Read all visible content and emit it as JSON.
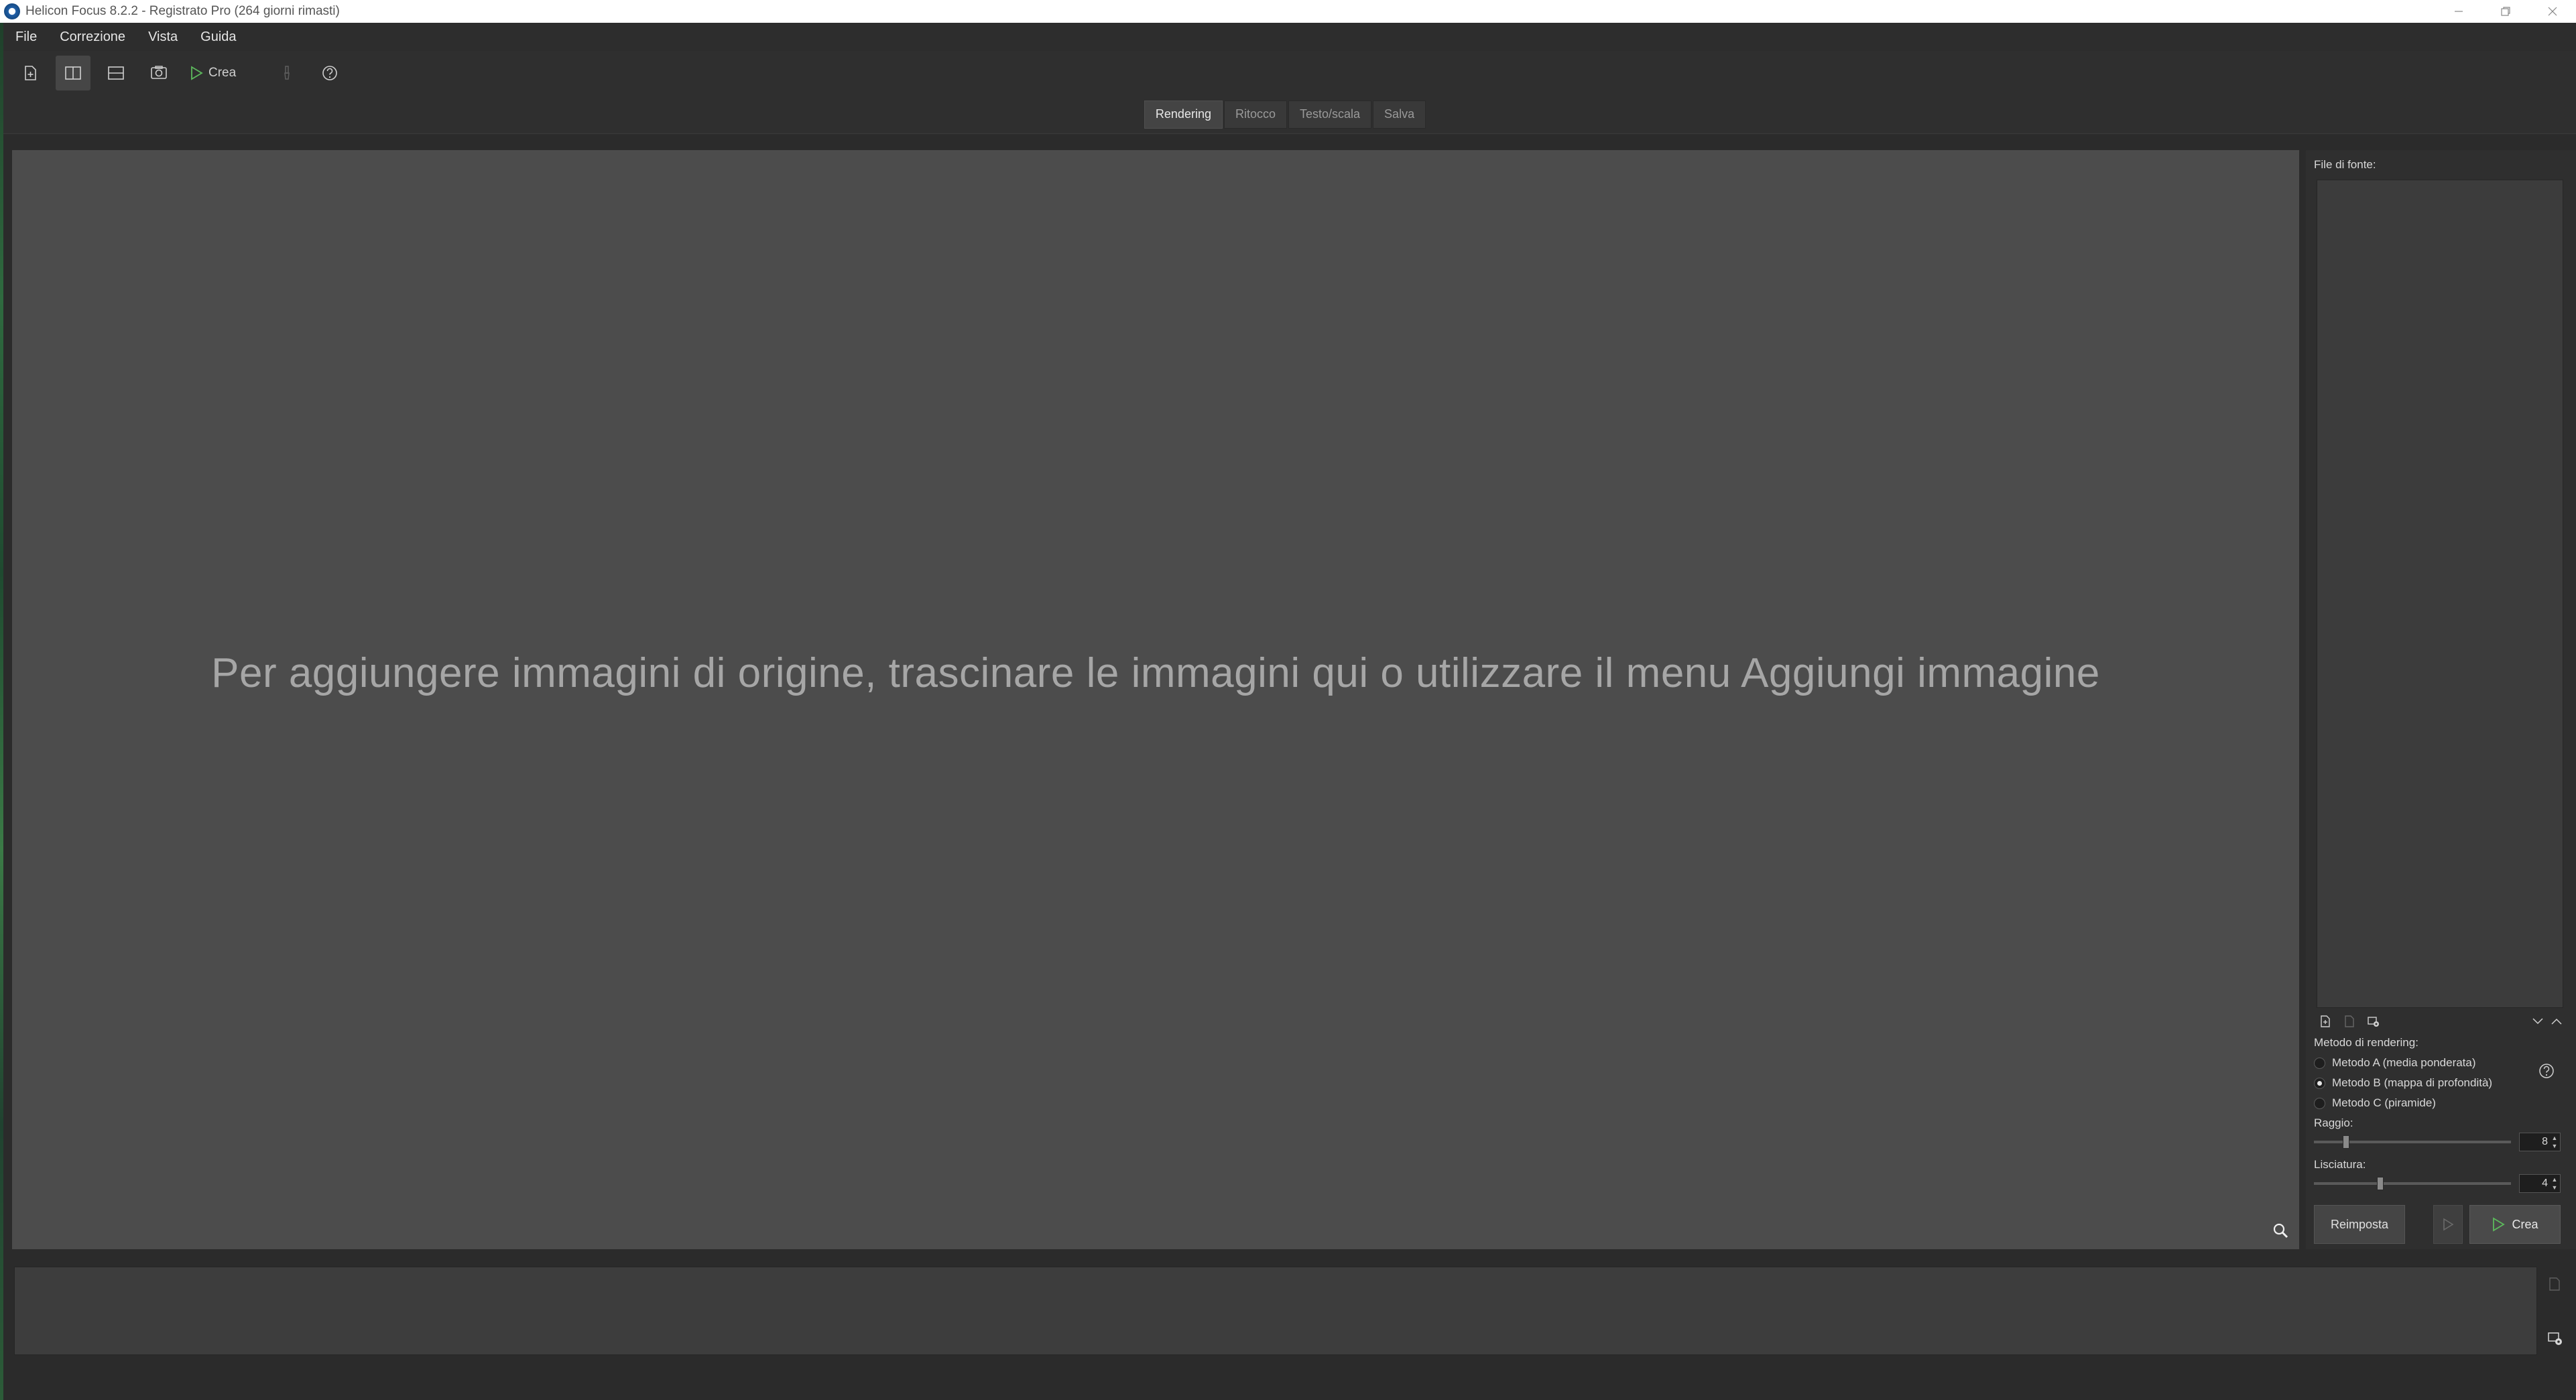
{
  "window": {
    "title": "Helicon Focus 8.2.2 - Registrato Pro  (264 giorni rimasti)",
    "controls": [
      "minimize-icon",
      "restore-icon",
      "close-icon"
    ]
  },
  "menu": {
    "items": [
      "File",
      "Correzione",
      "Vista",
      "Guida"
    ]
  },
  "toolbar": {
    "buttons": [
      {
        "icon": "add-file-icon"
      },
      {
        "icon": "split-vertical-icon",
        "active": true
      },
      {
        "icon": "split-horizontal-icon"
      },
      {
        "icon": "image-icon"
      },
      {
        "icon": "play-icon",
        "label": "Crea"
      },
      {
        "icon": "brush-icon",
        "disabled": true
      },
      {
        "icon": "help-icon"
      }
    ],
    "create_label": "Crea"
  },
  "tabs": [
    {
      "label": "Rendering",
      "active": true
    },
    {
      "label": "Ritocco"
    },
    {
      "label": "Testo/scala"
    },
    {
      "label": "Salva"
    }
  ],
  "canvas": {
    "hint": "Per aggiungere immagini di origine, trascinare le immagini qui o utilizzare il menu Aggiungi immagine"
  },
  "panel": {
    "files_label": "File di fonte:",
    "method_label": "Metodo di rendering:",
    "methods": [
      {
        "label": "Metodo A (media ponderata)",
        "checked": false
      },
      {
        "label": "Metodo B (mappa di profondità)",
        "checked": true
      },
      {
        "label": "Metodo C (piramide)",
        "checked": false
      }
    ],
    "radius_label": "Raggio:",
    "radius_value": "8",
    "radius_level": 0.15,
    "smoothing_label": "Lisciatura:",
    "smoothing_value": "4",
    "smoothing_level": 0.33,
    "reset_label": "Reimposta",
    "create_label": "Crea"
  },
  "colors": {
    "accent_green": "#5cb85c",
    "canvas_bg": "#4c4c4c",
    "panel_bg": "#2f2f2f"
  }
}
